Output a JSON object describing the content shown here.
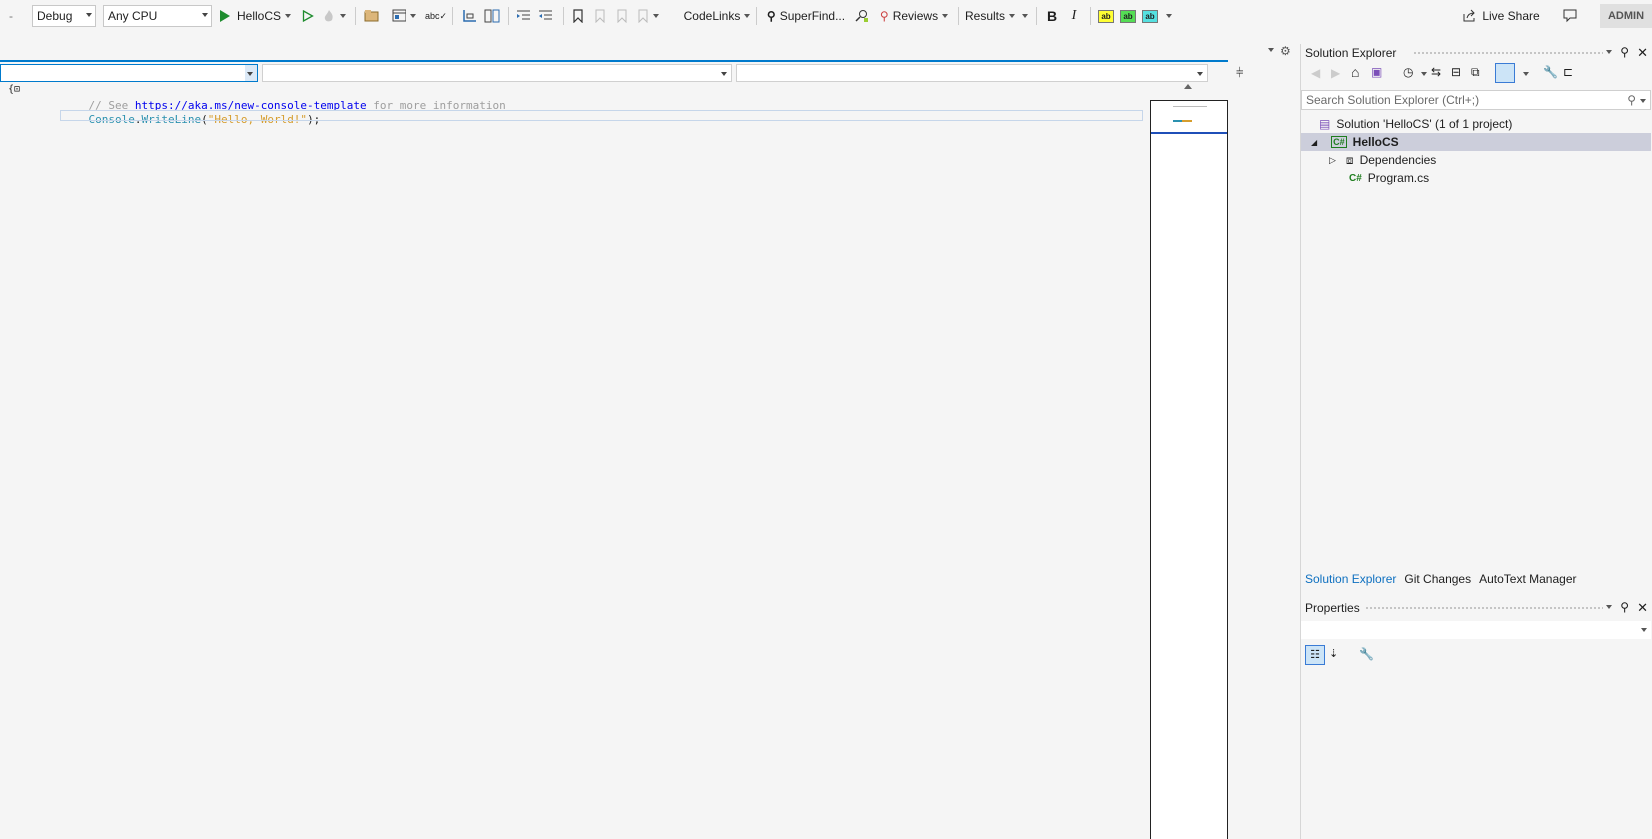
{
  "toolbar": {
    "config": "Debug",
    "platform": "Any CPU",
    "run_target": "HelloCS",
    "codelinks": "CodeLinks",
    "superfind": "SuperFind...",
    "reviews": "Reviews",
    "results": "Results",
    "bold": "B",
    "italic": "I",
    "highlight_label": "ab",
    "live_share": "Live Share",
    "user": "ADMIN",
    "colors": {
      "run_green": "#1e8c2e",
      "hl_yellow": "#ffff33",
      "hl_green": "#55dd55",
      "hl_cyan": "#55e0e0"
    }
  },
  "editor": {
    "code": {
      "line1_comment_prefix": "// See ",
      "line1_link": "https://aka.ms/new-console-template",
      "line1_comment_suffix": " for more information",
      "line2_type": "Console",
      "line2_dot": ".",
      "line2_method": "WriteLine",
      "line2_open": "(",
      "line2_string": "\"Hello, World!\"",
      "line2_close": ");"
    }
  },
  "solution_explorer": {
    "title": "Solution Explorer",
    "search_placeholder": "Search Solution Explorer (Ctrl+;)",
    "solution": "Solution 'HelloCS' (1 of 1 project)",
    "project": "HelloCS",
    "dependencies": "Dependencies",
    "file": "Program.cs",
    "tabs": [
      "Solution Explorer",
      "Git Changes",
      "AutoText Manager"
    ]
  },
  "properties": {
    "title": "Properties"
  }
}
